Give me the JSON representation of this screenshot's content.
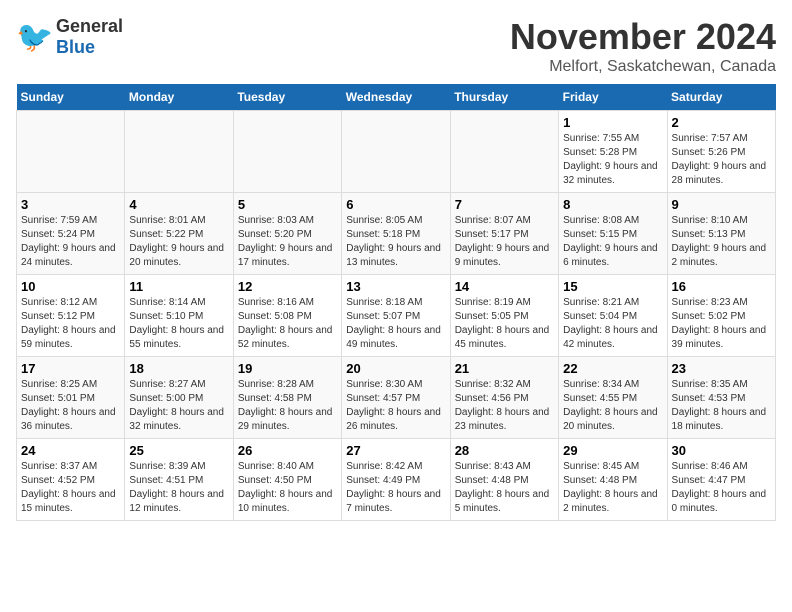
{
  "header": {
    "logo_general": "General",
    "logo_blue": "Blue",
    "month_year": "November 2024",
    "location": "Melfort, Saskatchewan, Canada"
  },
  "days_of_week": [
    "Sunday",
    "Monday",
    "Tuesday",
    "Wednesday",
    "Thursday",
    "Friday",
    "Saturday"
  ],
  "weeks": [
    [
      {
        "day": "",
        "empty": true
      },
      {
        "day": "",
        "empty": true
      },
      {
        "day": "",
        "empty": true
      },
      {
        "day": "",
        "empty": true
      },
      {
        "day": "",
        "empty": true
      },
      {
        "day": "1",
        "sunrise": "Sunrise: 7:55 AM",
        "sunset": "Sunset: 5:28 PM",
        "daylight": "Daylight: 9 hours and 32 minutes."
      },
      {
        "day": "2",
        "sunrise": "Sunrise: 7:57 AM",
        "sunset": "Sunset: 5:26 PM",
        "daylight": "Daylight: 9 hours and 28 minutes."
      }
    ],
    [
      {
        "day": "3",
        "sunrise": "Sunrise: 7:59 AM",
        "sunset": "Sunset: 5:24 PM",
        "daylight": "Daylight: 9 hours and 24 minutes."
      },
      {
        "day": "4",
        "sunrise": "Sunrise: 8:01 AM",
        "sunset": "Sunset: 5:22 PM",
        "daylight": "Daylight: 9 hours and 20 minutes."
      },
      {
        "day": "5",
        "sunrise": "Sunrise: 8:03 AM",
        "sunset": "Sunset: 5:20 PM",
        "daylight": "Daylight: 9 hours and 17 minutes."
      },
      {
        "day": "6",
        "sunrise": "Sunrise: 8:05 AM",
        "sunset": "Sunset: 5:18 PM",
        "daylight": "Daylight: 9 hours and 13 minutes."
      },
      {
        "day": "7",
        "sunrise": "Sunrise: 8:07 AM",
        "sunset": "Sunset: 5:17 PM",
        "daylight": "Daylight: 9 hours and 9 minutes."
      },
      {
        "day": "8",
        "sunrise": "Sunrise: 8:08 AM",
        "sunset": "Sunset: 5:15 PM",
        "daylight": "Daylight: 9 hours and 6 minutes."
      },
      {
        "day": "9",
        "sunrise": "Sunrise: 8:10 AM",
        "sunset": "Sunset: 5:13 PM",
        "daylight": "Daylight: 9 hours and 2 minutes."
      }
    ],
    [
      {
        "day": "10",
        "sunrise": "Sunrise: 8:12 AM",
        "sunset": "Sunset: 5:12 PM",
        "daylight": "Daylight: 8 hours and 59 minutes."
      },
      {
        "day": "11",
        "sunrise": "Sunrise: 8:14 AM",
        "sunset": "Sunset: 5:10 PM",
        "daylight": "Daylight: 8 hours and 55 minutes."
      },
      {
        "day": "12",
        "sunrise": "Sunrise: 8:16 AM",
        "sunset": "Sunset: 5:08 PM",
        "daylight": "Daylight: 8 hours and 52 minutes."
      },
      {
        "day": "13",
        "sunrise": "Sunrise: 8:18 AM",
        "sunset": "Sunset: 5:07 PM",
        "daylight": "Daylight: 8 hours and 49 minutes."
      },
      {
        "day": "14",
        "sunrise": "Sunrise: 8:19 AM",
        "sunset": "Sunset: 5:05 PM",
        "daylight": "Daylight: 8 hours and 45 minutes."
      },
      {
        "day": "15",
        "sunrise": "Sunrise: 8:21 AM",
        "sunset": "Sunset: 5:04 PM",
        "daylight": "Daylight: 8 hours and 42 minutes."
      },
      {
        "day": "16",
        "sunrise": "Sunrise: 8:23 AM",
        "sunset": "Sunset: 5:02 PM",
        "daylight": "Daylight: 8 hours and 39 minutes."
      }
    ],
    [
      {
        "day": "17",
        "sunrise": "Sunrise: 8:25 AM",
        "sunset": "Sunset: 5:01 PM",
        "daylight": "Daylight: 8 hours and 36 minutes."
      },
      {
        "day": "18",
        "sunrise": "Sunrise: 8:27 AM",
        "sunset": "Sunset: 5:00 PM",
        "daylight": "Daylight: 8 hours and 32 minutes."
      },
      {
        "day": "19",
        "sunrise": "Sunrise: 8:28 AM",
        "sunset": "Sunset: 4:58 PM",
        "daylight": "Daylight: 8 hours and 29 minutes."
      },
      {
        "day": "20",
        "sunrise": "Sunrise: 8:30 AM",
        "sunset": "Sunset: 4:57 PM",
        "daylight": "Daylight: 8 hours and 26 minutes."
      },
      {
        "day": "21",
        "sunrise": "Sunrise: 8:32 AM",
        "sunset": "Sunset: 4:56 PM",
        "daylight": "Daylight: 8 hours and 23 minutes."
      },
      {
        "day": "22",
        "sunrise": "Sunrise: 8:34 AM",
        "sunset": "Sunset: 4:55 PM",
        "daylight": "Daylight: 8 hours and 20 minutes."
      },
      {
        "day": "23",
        "sunrise": "Sunrise: 8:35 AM",
        "sunset": "Sunset: 4:53 PM",
        "daylight": "Daylight: 8 hours and 18 minutes."
      }
    ],
    [
      {
        "day": "24",
        "sunrise": "Sunrise: 8:37 AM",
        "sunset": "Sunset: 4:52 PM",
        "daylight": "Daylight: 8 hours and 15 minutes."
      },
      {
        "day": "25",
        "sunrise": "Sunrise: 8:39 AM",
        "sunset": "Sunset: 4:51 PM",
        "daylight": "Daylight: 8 hours and 12 minutes."
      },
      {
        "day": "26",
        "sunrise": "Sunrise: 8:40 AM",
        "sunset": "Sunset: 4:50 PM",
        "daylight": "Daylight: 8 hours and 10 minutes."
      },
      {
        "day": "27",
        "sunrise": "Sunrise: 8:42 AM",
        "sunset": "Sunset: 4:49 PM",
        "daylight": "Daylight: 8 hours and 7 minutes."
      },
      {
        "day": "28",
        "sunrise": "Sunrise: 8:43 AM",
        "sunset": "Sunset: 4:48 PM",
        "daylight": "Daylight: 8 hours and 5 minutes."
      },
      {
        "day": "29",
        "sunrise": "Sunrise: 8:45 AM",
        "sunset": "Sunset: 4:48 PM",
        "daylight": "Daylight: 8 hours and 2 minutes."
      },
      {
        "day": "30",
        "sunrise": "Sunrise: 8:46 AM",
        "sunset": "Sunset: 4:47 PM",
        "daylight": "Daylight: 8 hours and 0 minutes."
      }
    ]
  ]
}
